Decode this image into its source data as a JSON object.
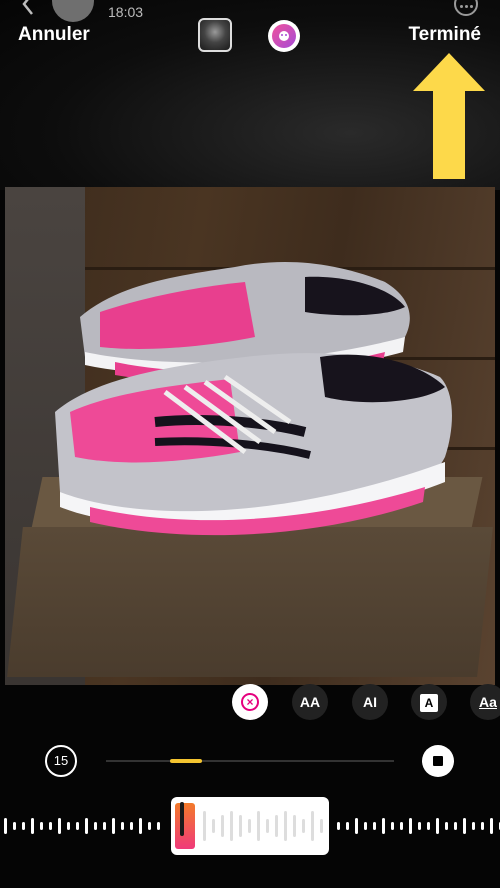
{
  "status": {
    "time": "18:03"
  },
  "header": {
    "cancel_label": "Annuler",
    "done_label": "Terminé"
  },
  "icons": {
    "back": "chevron-left-icon",
    "more": "more-horizontal-icon",
    "thumbnail": "music-cover-icon",
    "sticker": "sticker-face-icon",
    "arrow": "yellow-arrow-up-icon",
    "stop": "stop-icon"
  },
  "text_styles": [
    {
      "name": "remove",
      "label": ""
    },
    {
      "name": "aa-plain",
      "label": "AA"
    },
    {
      "name": "aa-bold",
      "label": "AI"
    },
    {
      "name": "a-box",
      "label": "A"
    },
    {
      "name": "aa-underline",
      "label": "Aa"
    }
  ],
  "player": {
    "timer": "15"
  },
  "colors": {
    "accent_yellow": "#f4c430",
    "arrow_yellow": "#fdd94a",
    "remove_pink": "#e5007e",
    "clip_gradient_start": "#f27a2a",
    "clip_gradient_end": "#f03a7a"
  }
}
